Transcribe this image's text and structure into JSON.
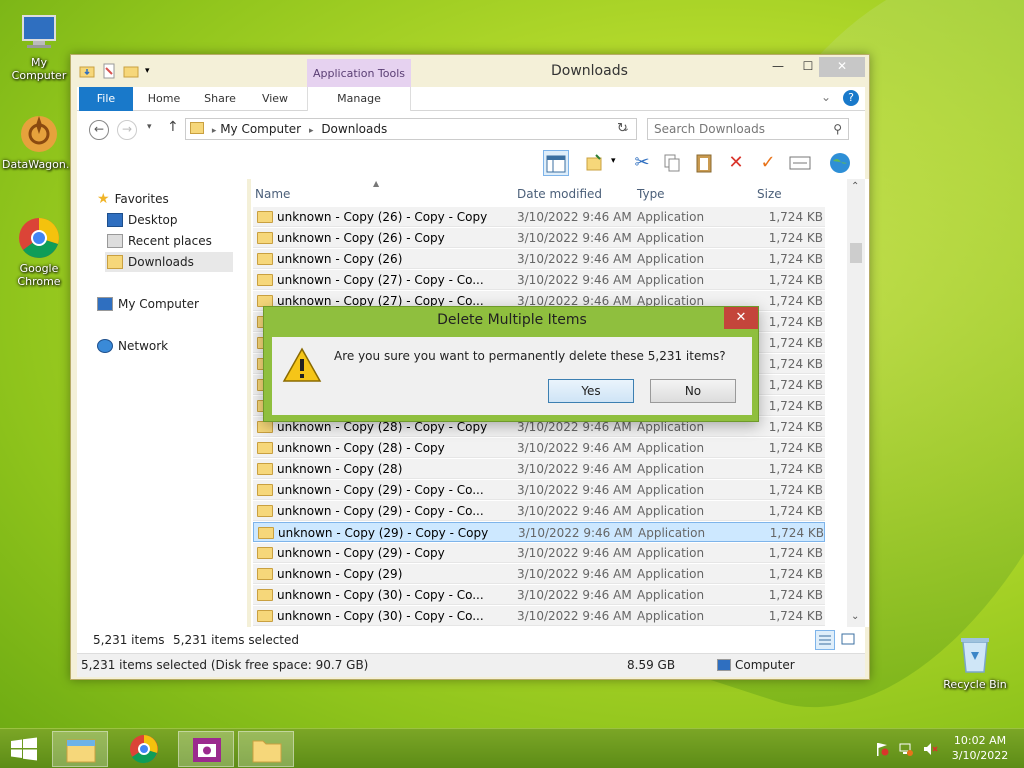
{
  "desktop": {
    "icons": [
      {
        "label": "My Computer"
      },
      {
        "label": "DataWagon..."
      },
      {
        "label": "Google Chrome"
      },
      {
        "label": "Recycle Bin"
      }
    ]
  },
  "window": {
    "title": "Downloads",
    "context_tab": "Application Tools",
    "ribbon_tabs": [
      "File",
      "Home",
      "Share",
      "View",
      "Manage"
    ],
    "address": {
      "crumbs": [
        "My Computer",
        "Downloads"
      ]
    },
    "search_placeholder": "Search Downloads",
    "nav": {
      "favorites": "Favorites",
      "favorites_items": [
        "Desktop",
        "Recent places",
        "Downloads"
      ],
      "computer": "My Computer",
      "network": "Network"
    },
    "columns": [
      "Name",
      "Date modified",
      "Type",
      "Size"
    ],
    "rows": [
      {
        "name": "unknown - Copy (26) - Copy - Copy",
        "date": "3/10/2022 9:46 AM",
        "type": "Application",
        "size": "1,724 KB"
      },
      {
        "name": "unknown - Copy (26) - Copy",
        "date": "3/10/2022 9:46 AM",
        "type": "Application",
        "size": "1,724 KB"
      },
      {
        "name": "unknown - Copy (26)",
        "date": "3/10/2022 9:46 AM",
        "type": "Application",
        "size": "1,724 KB"
      },
      {
        "name": "unknown - Copy (27) - Copy - Co...",
        "date": "3/10/2022 9:46 AM",
        "type": "Application",
        "size": "1,724 KB"
      },
      {
        "name": "unknown - Copy (27) - Copy - Co...",
        "date": "3/10/2022 9:46 AM",
        "type": "Application",
        "size": "1,724 KB"
      },
      {
        "name": "",
        "date": "",
        "type": "",
        "size": "1,724 KB"
      },
      {
        "name": "",
        "date": "",
        "type": "",
        "size": "1,724 KB"
      },
      {
        "name": "",
        "date": "",
        "type": "",
        "size": "1,724 KB"
      },
      {
        "name": "",
        "date": "",
        "type": "",
        "size": "1,724 KB"
      },
      {
        "name": "",
        "date": "",
        "type": "",
        "size": "1,724 KB"
      },
      {
        "name": "unknown - Copy (28) - Copy - Copy",
        "date": "3/10/2022 9:46 AM",
        "type": "Application",
        "size": "1,724 KB"
      },
      {
        "name": "unknown - Copy (28) - Copy",
        "date": "3/10/2022 9:46 AM",
        "type": "Application",
        "size": "1,724 KB"
      },
      {
        "name": "unknown - Copy (28)",
        "date": "3/10/2022 9:46 AM",
        "type": "Application",
        "size": "1,724 KB"
      },
      {
        "name": "unknown - Copy (29) - Copy - Co...",
        "date": "3/10/2022 9:46 AM",
        "type": "Application",
        "size": "1,724 KB"
      },
      {
        "name": "unknown - Copy (29) - Copy - Co...",
        "date": "3/10/2022 9:46 AM",
        "type": "Application",
        "size": "1,724 KB"
      },
      {
        "name": "unknown - Copy (29) - Copy - Copy",
        "date": "3/10/2022 9:46 AM",
        "type": "Application",
        "size": "1,724 KB",
        "selected": true
      },
      {
        "name": "unknown - Copy (29) - Copy",
        "date": "3/10/2022 9:46 AM",
        "type": "Application",
        "size": "1,724 KB"
      },
      {
        "name": "unknown - Copy (29)",
        "date": "3/10/2022 9:46 AM",
        "type": "Application",
        "size": "1,724 KB"
      },
      {
        "name": "unknown - Copy (30) - Copy - Co...",
        "date": "3/10/2022 9:46 AM",
        "type": "Application",
        "size": "1,724 KB"
      },
      {
        "name": "unknown - Copy (30) - Copy - Co...",
        "date": "3/10/2022 9:46 AM",
        "type": "Application",
        "size": "1,724 KB"
      }
    ],
    "status": {
      "count": "5,231 items",
      "selected": "5,231 items selected"
    },
    "details": {
      "summary": "5,231 items selected (Disk free space: 90.7 GB)",
      "size": "8.59 GB",
      "location": "Computer"
    }
  },
  "dialog": {
    "title": "Delete Multiple Items",
    "message": "Are you sure you want to permanently delete these 5,231 items?",
    "yes": "Yes",
    "no": "No"
  },
  "taskbar": {
    "time": "10:02 AM",
    "date": "3/10/2022"
  },
  "colors": {
    "file_tab": "#1979ca",
    "dialog_frame": "#8fbf3e",
    "close_red": "#c4453b",
    "selection": "#cde8ff"
  }
}
